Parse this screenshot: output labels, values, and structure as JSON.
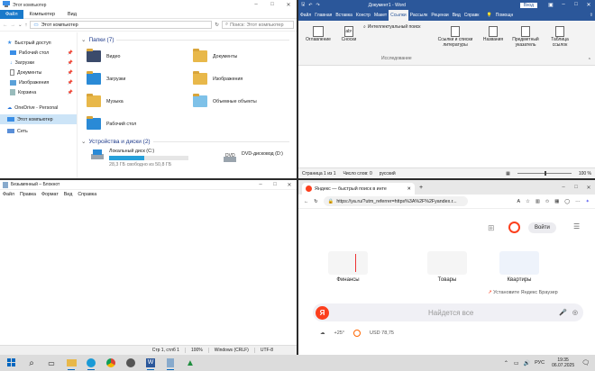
{
  "explorer": {
    "title": "Этот компьютер",
    "ribbon": {
      "file": "Файл",
      "tabs": [
        "Компьютер",
        "Вид"
      ]
    },
    "address": "Этот компьютер",
    "search_placeholder": "Поиск: Этот компьютер",
    "sidebar": [
      {
        "label": "Быстрый доступ",
        "icon": "star-icon",
        "pinned": false
      },
      {
        "label": "Рабочий стол",
        "icon": "desktop-icon",
        "pinned": true
      },
      {
        "label": "Загрузки",
        "icon": "download-icon",
        "pinned": true
      },
      {
        "label": "Документы",
        "icon": "document-icon",
        "pinned": true
      },
      {
        "label": "Изображения",
        "icon": "image-icon",
        "pinned": true
      },
      {
        "label": "Корзина",
        "icon": "recycle-bin-icon",
        "pinned": true
      },
      {
        "label": "OneDrive - Personal",
        "icon": "cloud-icon",
        "pinned": false
      },
      {
        "label": "Этот компьютер",
        "icon": "computer-icon",
        "pinned": false,
        "selected": true
      },
      {
        "label": "Сеть",
        "icon": "network-icon",
        "pinned": false
      }
    ],
    "folders_header": "Папки (7)",
    "folders": [
      "Видео",
      "Документы",
      "Загрузки",
      "Изображения",
      "Музыка",
      "Объемные объекты",
      "Рабочий стол"
    ],
    "drives_header": "Устройства и диски (2)",
    "drives": [
      {
        "name": "Локальный диск (C:)",
        "free": "28,3 ГБ свободно из 50,8 ГБ",
        "used_fraction": 0.44
      },
      {
        "name": "DVD-дисковод (D:)",
        "free": "",
        "used_fraction": null
      }
    ]
  },
  "word": {
    "title": "Документ1 - Word",
    "signin": "Вход",
    "tabs": [
      "Файл",
      "Главная",
      "Вставка",
      "Констр",
      "Макет",
      "Ссылки",
      "Рассылк",
      "Рецензи",
      "Вид",
      "Справк"
    ],
    "active_tab": "Ссылки",
    "help": "Помощн",
    "groups": [
      "Оглавление",
      "Сноски",
      "Интеллектуальный поиск",
      "Ссылки и списки литературы",
      "Названия",
      "Предметный указатель",
      "Таблица ссылок"
    ],
    "group_caption": "Исследование",
    "status": [
      "Страница 1 из 1",
      "Число слов: 0",
      "русский"
    ],
    "zoom": "100 %"
  },
  "notepad": {
    "title": "Безымянный – Блокнот",
    "menu": [
      "Файл",
      "Правка",
      "Формат",
      "Вид",
      "Справка"
    ],
    "status": [
      "Стр 1, стлб 1",
      "100%",
      "Windows (CRLF)",
      "UTF-8"
    ]
  },
  "browser": {
    "tab_title": "Яндекс — быстрый поиск в инте",
    "url": "https://ya.ru/?utm_referrer=https%3A%2F%2Fyandex.r...",
    "login": "Войти",
    "services": [
      "Финансы",
      "Товары",
      "Квартиры"
    ],
    "install_hint": "Установите Яндекс Браузер",
    "search_placeholder": "Найдется все",
    "weather": "+25°",
    "usd": "USD 78,75"
  },
  "taskbar": {
    "icons": [
      "windows-start-icon",
      "search-icon",
      "task-view-icon",
      "file-explorer-icon",
      "edge-icon",
      "chrome-icon",
      "yandex-browser-icon",
      "word-icon",
      "notepad-icon",
      "paint-icon"
    ],
    "language": "РУС",
    "time": "19:35",
    "date": "06.07.2025"
  }
}
